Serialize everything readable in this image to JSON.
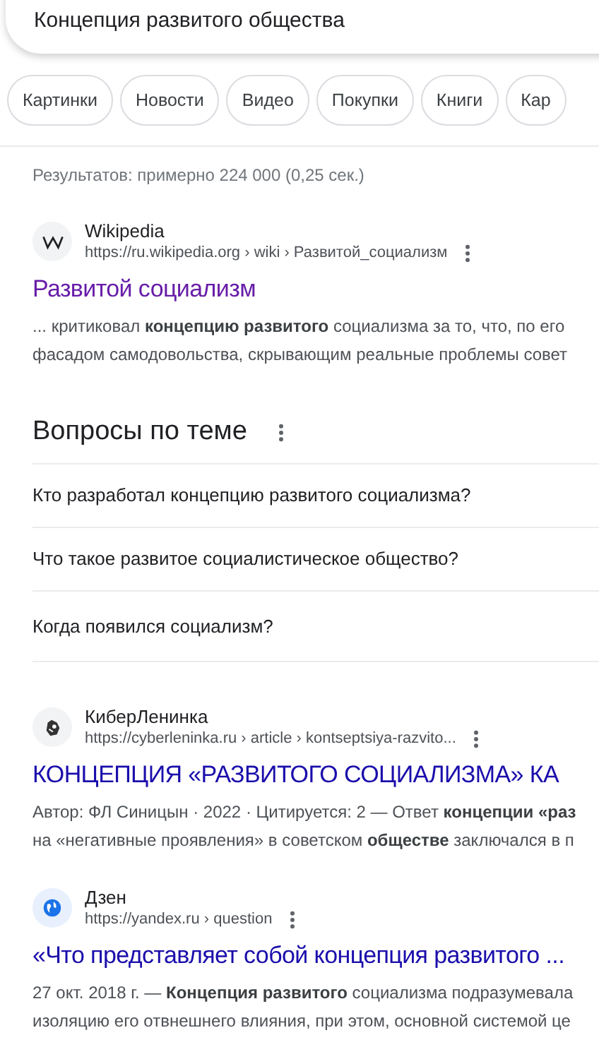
{
  "search": {
    "value": "Концепция развитого общества"
  },
  "chips": [
    {
      "label": "Картинки"
    },
    {
      "label": "Новости"
    },
    {
      "label": "Видео"
    },
    {
      "label": "Покупки"
    },
    {
      "label": "Книги"
    },
    {
      "label": "Кар"
    }
  ],
  "result_stats": "Результатов: примерно 224 000 (0,25 сек.)",
  "blocks": [
    {
      "kind": "result",
      "site": "Wikipedia",
      "url": "https://ru.wikipedia.org › wiki › Развитой_социализм",
      "title": "Развитой социализм",
      "visited": true,
      "snippet_lines": [
        "... критиковал **концепцию развитого** социализма за то, что, по его",
        "фасадом самодовольства, скрывающим реальные проблемы совет"
      ]
    },
    {
      "kind": "questions",
      "heading": "Вопросы по теме",
      "questions": [
        "Кто разработал концепцию развитого социализма?",
        "Что такое развитое социалистическое общество?",
        "Когда появился социализм?"
      ]
    },
    {
      "kind": "result",
      "site": "КиберЛенинка",
      "url": "https://cyberleninka.ru › article › kontseptsiya-razvito...",
      "title": "КОНЦЕПЦИЯ «РАЗВИТОГО СОЦИАЛИЗМА» КА",
      "visited": false,
      "snippet_lines": [
        "Автор: ФЛ Синицын · 2022 · Цитируется: 2 — Ответ **концепции «раз**",
        "на «негативные проявления» в советском **обществе** заключался в п"
      ]
    },
    {
      "kind": "result",
      "site": "Дзен",
      "url": "https://yandex.ru › question",
      "title": "«Что представляет собой концепция развитого ...",
      "visited": false,
      "snippet_lines": [
        "27 окт. 2018 г. — **Концепция развитого** социализма подразумевала",
        "изоляцию его отвнешнего влияния, при этом, основной системой це"
      ]
    }
  ]
}
